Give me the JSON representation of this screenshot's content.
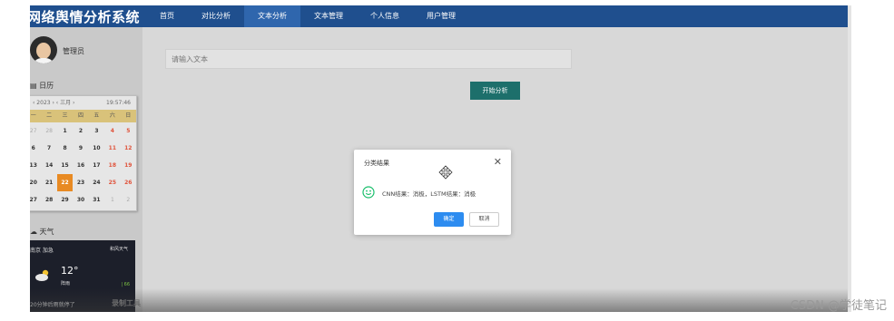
{
  "header": {
    "brand": "网络舆情分析系统",
    "nav": [
      "首页",
      "对比分析",
      "文本分析",
      "文本管理",
      "个人信息",
      "用户管理"
    ],
    "active_index": 2
  },
  "sidebar": {
    "user_name": "管理员",
    "calendar": {
      "label": "日历",
      "year_nav": "‹ 2023 › ‹ 三月 ›",
      "time": "19:57:46",
      "weekdays": [
        "一",
        "二",
        "三",
        "四",
        "五",
        "六",
        "日"
      ],
      "days": [
        {
          "d": "27",
          "t": "other"
        },
        {
          "d": "28",
          "t": "other"
        },
        {
          "d": "1",
          "t": ""
        },
        {
          "d": "2",
          "t": ""
        },
        {
          "d": "3",
          "t": ""
        },
        {
          "d": "4",
          "t": "wkend"
        },
        {
          "d": "5",
          "t": "wkend"
        },
        {
          "d": "6",
          "t": ""
        },
        {
          "d": "7",
          "t": ""
        },
        {
          "d": "8",
          "t": ""
        },
        {
          "d": "9",
          "t": ""
        },
        {
          "d": "10",
          "t": ""
        },
        {
          "d": "11",
          "t": "wkend"
        },
        {
          "d": "12",
          "t": "wkend"
        },
        {
          "d": "13",
          "t": ""
        },
        {
          "d": "14",
          "t": ""
        },
        {
          "d": "15",
          "t": ""
        },
        {
          "d": "16",
          "t": ""
        },
        {
          "d": "17",
          "t": ""
        },
        {
          "d": "18",
          "t": "wkend"
        },
        {
          "d": "19",
          "t": "wkend"
        },
        {
          "d": "20",
          "t": ""
        },
        {
          "d": "21",
          "t": ""
        },
        {
          "d": "22",
          "t": "today"
        },
        {
          "d": "23",
          "t": ""
        },
        {
          "d": "24",
          "t": ""
        },
        {
          "d": "25",
          "t": "wkend"
        },
        {
          "d": "26",
          "t": "wkend"
        },
        {
          "d": "27",
          "t": ""
        },
        {
          "d": "28",
          "t": ""
        },
        {
          "d": "29",
          "t": ""
        },
        {
          "d": "30",
          "t": ""
        },
        {
          "d": "31",
          "t": ""
        },
        {
          "d": "1",
          "t": "other"
        },
        {
          "d": "2",
          "t": "other"
        }
      ]
    },
    "weather": {
      "label": "天气",
      "city": "南京 加急",
      "source": "和风天气",
      "temp": "12°",
      "condition": "阵雨",
      "aqi": "| 66",
      "note": "20分钟后雨就停了"
    },
    "watermark": "录制工具"
  },
  "main": {
    "input_placeholder": "请输入文本",
    "analyze_button": "开始分析"
  },
  "dialog": {
    "title": "分类结果",
    "close_glyph": "✕",
    "message": "CNN结果：消极，LSTM结果：消极",
    "ok_label": "确定",
    "cancel_label": "取消"
  },
  "footer_watermark": "CSDN @学徒笔记",
  "colors": {
    "header_bg": "#1f4f8e",
    "nav_active": "#2f66ad",
    "analyze_btn": "#1d6f6b",
    "ok_btn": "#2d8cf0",
    "today": "#e88a23",
    "smile": "#19be6b"
  }
}
